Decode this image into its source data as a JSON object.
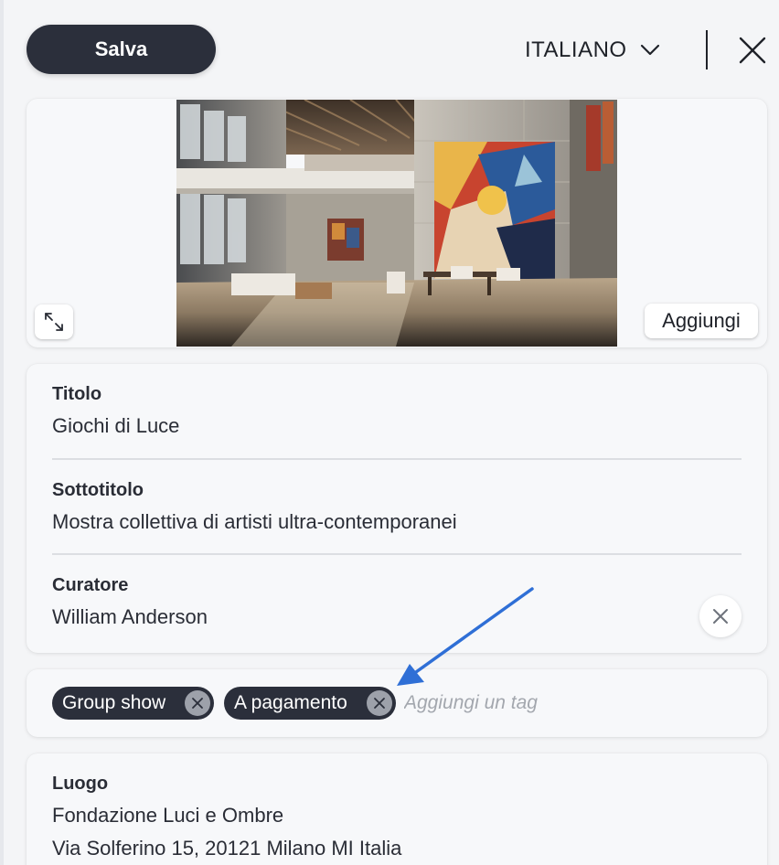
{
  "header": {
    "save_label": "Salva",
    "language": "ITALIANO"
  },
  "image_panel": {
    "add_label": "Aggiungi"
  },
  "fields": {
    "title_label": "Titolo",
    "title_value": "Giochi di Luce",
    "subtitle_label": "Sottotitolo",
    "subtitle_value": "Mostra collettiva di artisti ultra-contemporanei",
    "curator_label": "Curatore",
    "curator_value": "William Anderson"
  },
  "tags": {
    "items": [
      "Group show",
      "A pagamento"
    ],
    "placeholder": "Aggiungi un tag"
  },
  "location": {
    "label": "Luogo",
    "venue": "Fondazione Luci e Ombre",
    "address": "Via Solferino 15, 20121 Milano MI Italia"
  },
  "colors": {
    "accent_dark": "#2b2f3b",
    "annotation_arrow": "#2f6fd6"
  },
  "icons": [
    "chevron-down-icon",
    "close-icon",
    "expand-icon",
    "clear-icon",
    "tag-remove-icon",
    "annotation-arrow-icon"
  ]
}
